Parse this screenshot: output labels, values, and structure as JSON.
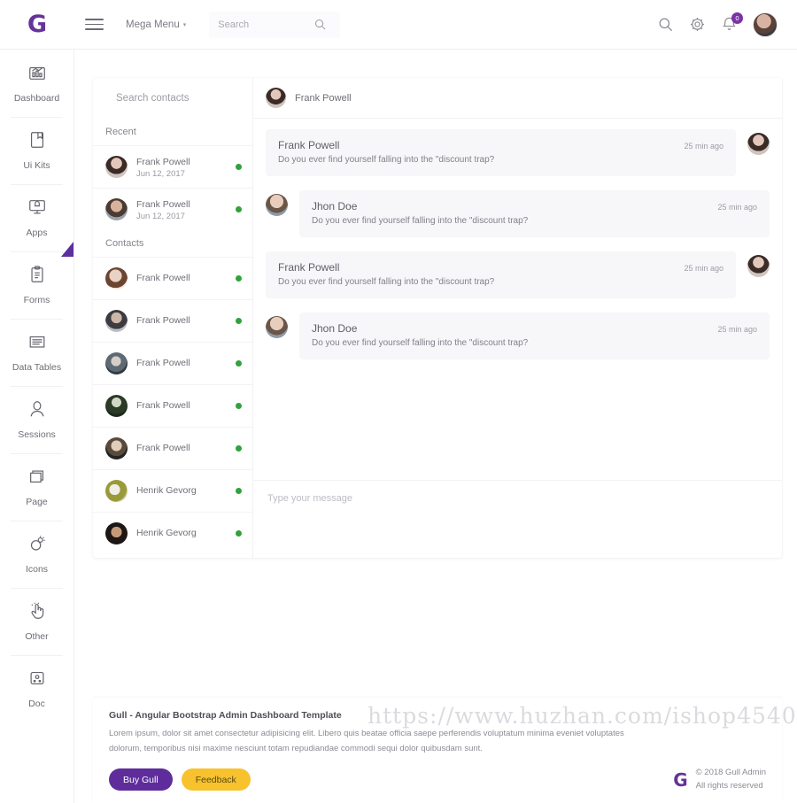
{
  "header": {
    "brand": "G",
    "menu_label": "Mega Menu",
    "caret": "▾",
    "search_placeholder": "Search",
    "search_value": "",
    "icons": {
      "search": "search-icon",
      "gear": "gear-icon",
      "bell": "bell-icon"
    },
    "notification_count": "0"
  },
  "sidebar": {
    "items": [
      {
        "label": "Dashboard",
        "icon": "chart-bar-icon",
        "active": false
      },
      {
        "label": "Ui Kits",
        "icon": "book-icon",
        "active": false
      },
      {
        "label": "Apps",
        "icon": "monitor-icon",
        "active": true
      },
      {
        "label": "Forms",
        "icon": "clipboard-icon",
        "active": false
      },
      {
        "label": "Data Tables",
        "icon": "table-icon",
        "active": false
      },
      {
        "label": "Sessions",
        "icon": "user-icon",
        "active": false
      },
      {
        "label": "Page",
        "icon": "layers-icon",
        "active": false
      },
      {
        "label": "Icons",
        "icon": "weather-icon",
        "active": false
      },
      {
        "label": "Other",
        "icon": "hand-pointer-icon",
        "active": false
      },
      {
        "label": "Doc",
        "icon": "box-icon",
        "active": false
      }
    ]
  },
  "chat": {
    "contacts_search_placeholder": "Search contacts",
    "contacts_search_value": "",
    "section_recent": "Recent",
    "section_contacts": "Contacts",
    "recent": [
      {
        "name": "Frank Powell",
        "date": "Jun 12, 2017",
        "status": "online",
        "avatar": "avatar-woman-dark"
      },
      {
        "name": "Frank Powell",
        "date": "Jun 12, 2017",
        "status": "online",
        "avatar": "avatar-man-beard"
      }
    ],
    "contacts": [
      {
        "name": "Frank Powell",
        "status": "online",
        "avatar": "avatar-man-brown"
      },
      {
        "name": "Frank Powell",
        "status": "online",
        "avatar": "avatar-man-glasses"
      },
      {
        "name": "Frank Powell",
        "status": "online",
        "avatar": "avatar-man-cap"
      },
      {
        "name": "Frank Powell",
        "status": "online",
        "avatar": "avatar-man-green"
      },
      {
        "name": "Frank Powell",
        "status": "online",
        "avatar": "avatar-man-hat"
      },
      {
        "name": "Henrik Gevorg",
        "status": "online",
        "avatar": "avatar-olive"
      },
      {
        "name": "Henrik Gevorg",
        "status": "online",
        "avatar": "avatar-dark"
      }
    ],
    "active_contact": "Frank Powell",
    "messages": [
      {
        "name": "Frank Powell",
        "text": "Do you ever find yourself falling into the \"discount trap?",
        "time": "25 min ago",
        "side": "mine",
        "avatar": "avatar-woman-dark"
      },
      {
        "name": "Jhon Doe",
        "text": "Do you ever find yourself falling into the \"discount trap?",
        "time": "25 min ago",
        "side": "theirs",
        "avatar": "avatar-man-beard"
      },
      {
        "name": "Frank Powell",
        "text": "Do you ever find yourself falling into the \"discount trap?",
        "time": "25 min ago",
        "side": "mine",
        "avatar": "avatar-woman-dark"
      },
      {
        "name": "Jhon Doe",
        "text": "Do you ever find yourself falling into the \"discount trap?",
        "time": "25 min ago",
        "side": "theirs",
        "avatar": "avatar-man-beard"
      }
    ],
    "input_placeholder": "Type your message",
    "input_value": ""
  },
  "footer": {
    "title": "Gull - Angular Bootstrap Admin Dashboard Template",
    "description": "Lorem ipsum, dolor sit amet consectetur adipisicing elit. Libero quis beatae officia saepe perferendis voluptatum minima eveniet voluptates dolorum, temporibus nisi maxime nesciunt totam repudiandae commodi sequi dolor quibusdam sunt.",
    "buy_label": "Buy Gull",
    "feedback_label": "Feedback",
    "copy_brand": "G",
    "copyright_line1": "© 2018 Gull Admin",
    "copyright_line2": "All rights reserved"
  },
  "watermark": "https://www.huzhan.com/ishop4540",
  "colors": {
    "brand_purple": "#663399",
    "button_purple": "#5e2d9b",
    "accent_yellow": "#f7c22e",
    "online_green": "#31a23c",
    "badge_purple": "#7b32a8"
  }
}
